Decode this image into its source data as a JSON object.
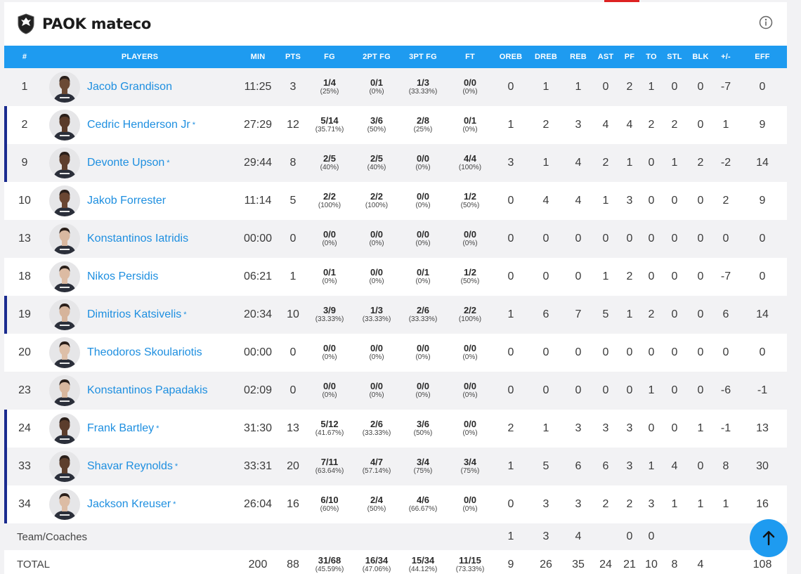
{
  "header": {
    "title": "PAOK mateco",
    "logo_icon": "paok-crest-icon",
    "info_icon": "info-icon"
  },
  "columns": [
    "#",
    "PLAYERS",
    "MIN",
    "PTS",
    "FG",
    "2PT FG",
    "3PT FG",
    "FT",
    "OREB",
    "DREB",
    "REB",
    "AST",
    "PF",
    "TO",
    "STL",
    "BLK",
    "+/-",
    "EFF"
  ],
  "players": [
    {
      "num": "1",
      "name": "Jacob Grandison",
      "starter": false,
      "min": "11:25",
      "pts": "3",
      "fg": [
        "1/4",
        "(25%)"
      ],
      "fg2": [
        "0/1",
        "(0%)"
      ],
      "fg3": [
        "1/3",
        "(33.33%)"
      ],
      "ft": [
        "0/0",
        "(0%)"
      ],
      "oreb": "0",
      "dreb": "1",
      "reb": "1",
      "ast": "0",
      "pf": "2",
      "to": "1",
      "stl": "0",
      "blk": "0",
      "pm": "-7",
      "eff": "0",
      "skin": "#6b4a35"
    },
    {
      "num": "2",
      "name": "Cedric Henderson Jr",
      "starter": true,
      "min": "27:29",
      "pts": "12",
      "fg": [
        "5/14",
        "(35.71%)"
      ],
      "fg2": [
        "3/6",
        "(50%)"
      ],
      "fg3": [
        "2/8",
        "(25%)"
      ],
      "ft": [
        "0/1",
        "(0%)"
      ],
      "oreb": "1",
      "dreb": "2",
      "reb": "3",
      "ast": "4",
      "pf": "4",
      "to": "2",
      "stl": "2",
      "blk": "0",
      "pm": "1",
      "eff": "9",
      "skin": "#5a3b2a"
    },
    {
      "num": "9",
      "name": "Devonte Upson",
      "starter": true,
      "min": "29:44",
      "pts": "8",
      "fg": [
        "2/5",
        "(40%)"
      ],
      "fg2": [
        "2/5",
        "(40%)"
      ],
      "fg3": [
        "0/0",
        "(0%)"
      ],
      "ft": [
        "4/4",
        "(100%)"
      ],
      "oreb": "3",
      "dreb": "1",
      "reb": "4",
      "ast": "2",
      "pf": "1",
      "to": "0",
      "stl": "1",
      "blk": "2",
      "pm": "-2",
      "eff": "14",
      "skin": "#5e3f2e"
    },
    {
      "num": "10",
      "name": "Jakob Forrester",
      "starter": false,
      "min": "11:14",
      "pts": "5",
      "fg": [
        "2/2",
        "(100%)"
      ],
      "fg2": [
        "2/2",
        "(100%)"
      ],
      "fg3": [
        "0/0",
        "(0%)"
      ],
      "ft": [
        "1/2",
        "(50%)"
      ],
      "oreb": "0",
      "dreb": "4",
      "reb": "4",
      "ast": "1",
      "pf": "3",
      "to": "0",
      "stl": "0",
      "blk": "0",
      "pm": "2",
      "eff": "9",
      "skin": "#6a4632"
    },
    {
      "num": "13",
      "name": "Konstantinos Iatridis",
      "starter": false,
      "min": "00:00",
      "pts": "0",
      "fg": [
        "0/0",
        "(0%)"
      ],
      "fg2": [
        "0/0",
        "(0%)"
      ],
      "fg3": [
        "0/0",
        "(0%)"
      ],
      "ft": [
        "0/0",
        "(0%)"
      ],
      "oreb": "0",
      "dreb": "0",
      "reb": "0",
      "ast": "0",
      "pf": "0",
      "to": "0",
      "stl": "0",
      "blk": "0",
      "pm": "0",
      "eff": "0",
      "skin": "#d9b8a0"
    },
    {
      "num": "18",
      "name": "Nikos Persidis",
      "starter": false,
      "min": "06:21",
      "pts": "1",
      "fg": [
        "0/1",
        "(0%)"
      ],
      "fg2": [
        "0/0",
        "(0%)"
      ],
      "fg3": [
        "0/1",
        "(0%)"
      ],
      "ft": [
        "1/2",
        "(50%)"
      ],
      "oreb": "0",
      "dreb": "0",
      "reb": "0",
      "ast": "1",
      "pf": "2",
      "to": "0",
      "stl": "0",
      "blk": "0",
      "pm": "-7",
      "eff": "0",
      "skin": "#dcbba3"
    },
    {
      "num": "19",
      "name": "Dimitrios Katsivelis",
      "starter": true,
      "min": "20:34",
      "pts": "10",
      "fg": [
        "3/9",
        "(33.33%)"
      ],
      "fg2": [
        "1/3",
        "(33.33%)"
      ],
      "fg3": [
        "2/6",
        "(33.33%)"
      ],
      "ft": [
        "2/2",
        "(100%)"
      ],
      "oreb": "1",
      "dreb": "6",
      "reb": "7",
      "ast": "5",
      "pf": "1",
      "to": "2",
      "stl": "0",
      "blk": "0",
      "pm": "6",
      "eff": "14",
      "skin": "#d6b49b"
    },
    {
      "num": "20",
      "name": "Theodoros Skoulariotis",
      "starter": false,
      "min": "00:00",
      "pts": "0",
      "fg": [
        "0/0",
        "(0%)"
      ],
      "fg2": [
        "0/0",
        "(0%)"
      ],
      "fg3": [
        "0/0",
        "(0%)"
      ],
      "ft": [
        "0/0",
        "(0%)"
      ],
      "oreb": "0",
      "dreb": "0",
      "reb": "0",
      "ast": "0",
      "pf": "0",
      "to": "0",
      "stl": "0",
      "blk": "0",
      "pm": "0",
      "eff": "0",
      "skin": "#ddbfa8"
    },
    {
      "num": "23",
      "name": "Konstantinos Papadakis",
      "starter": false,
      "min": "02:09",
      "pts": "0",
      "fg": [
        "0/0",
        "(0%)"
      ],
      "fg2": [
        "0/0",
        "(0%)"
      ],
      "fg3": [
        "0/0",
        "(0%)"
      ],
      "ft": [
        "0/0",
        "(0%)"
      ],
      "oreb": "0",
      "dreb": "0",
      "reb": "0",
      "ast": "0",
      "pf": "0",
      "to": "1",
      "stl": "0",
      "blk": "0",
      "pm": "-6",
      "eff": "-1",
      "skin": "#d8b79e"
    },
    {
      "num": "24",
      "name": "Frank Bartley",
      "starter": true,
      "min": "31:30",
      "pts": "13",
      "fg": [
        "5/12",
        "(41.67%)"
      ],
      "fg2": [
        "2/6",
        "(33.33%)"
      ],
      "fg3": [
        "3/6",
        "(50%)"
      ],
      "ft": [
        "0/0",
        "(0%)"
      ],
      "oreb": "2",
      "dreb": "1",
      "reb": "3",
      "ast": "3",
      "pf": "3",
      "to": "0",
      "stl": "0",
      "blk": "1",
      "pm": "-1",
      "eff": "13",
      "skin": "#5b3d2c"
    },
    {
      "num": "33",
      "name": "Shavar Reynolds",
      "starter": true,
      "min": "33:31",
      "pts": "20",
      "fg": [
        "7/11",
        "(63.64%)"
      ],
      "fg2": [
        "4/7",
        "(57.14%)"
      ],
      "fg3": [
        "3/4",
        "(75%)"
      ],
      "ft": [
        "3/4",
        "(75%)"
      ],
      "oreb": "1",
      "dreb": "5",
      "reb": "6",
      "ast": "6",
      "pf": "3",
      "to": "1",
      "stl": "4",
      "blk": "0",
      "pm": "8",
      "eff": "30",
      "skin": "#5d3f2d"
    },
    {
      "num": "34",
      "name": "Jackson Kreuser",
      "starter": true,
      "min": "26:04",
      "pts": "16",
      "fg": [
        "6/10",
        "(60%)"
      ],
      "fg2": [
        "2/4",
        "(50%)"
      ],
      "fg3": [
        "4/6",
        "(66.67%)"
      ],
      "ft": [
        "0/0",
        "(0%)"
      ],
      "oreb": "0",
      "dreb": "3",
      "reb": "3",
      "ast": "2",
      "pf": "2",
      "to": "3",
      "stl": "1",
      "blk": "1",
      "pm": "1",
      "eff": "16",
      "skin": "#dcbca4"
    }
  ],
  "team_row": {
    "label": "Team/Coaches",
    "oreb": "1",
    "dreb": "3",
    "reb": "4",
    "ast": "",
    "pf": "0",
    "to": "0",
    "stl": "",
    "blk": "",
    "pm": "",
    "eff": ""
  },
  "total_row": {
    "label": "TOTAL",
    "min": "200",
    "pts": "88",
    "fg": [
      "31/68",
      "(45.59%)"
    ],
    "fg2": [
      "16/34",
      "(47.06%)"
    ],
    "fg3": [
      "15/34",
      "(44.12%)"
    ],
    "ft": [
      "11/15",
      "(73.33%)"
    ],
    "oreb": "9",
    "dreb": "26",
    "reb": "35",
    "ast": "24",
    "pf": "21",
    "to": "10",
    "stl": "8",
    "blk": "4",
    "pm": "",
    "eff": "108"
  },
  "starter_mark": "*",
  "scroll_top_icon": "arrow-up-icon",
  "colors": {
    "header_blue": "#1e9bf0",
    "link_blue": "#1e8fe0",
    "starter_bar": "#1a2b8f"
  }
}
